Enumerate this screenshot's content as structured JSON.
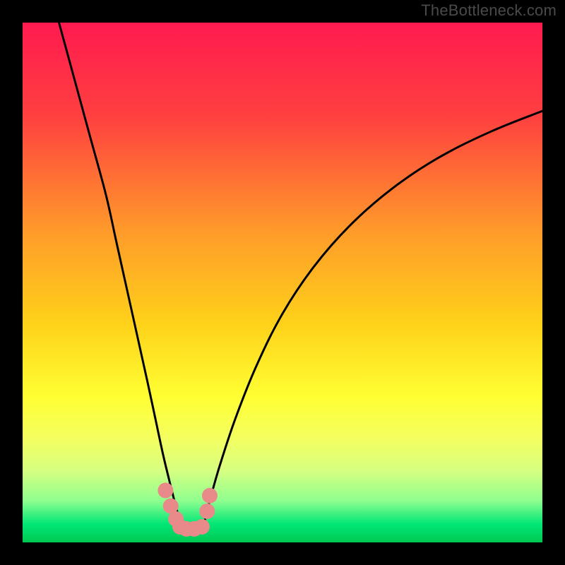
{
  "watermark": "TheBottleneck.com",
  "chart_data": {
    "type": "line",
    "title": "",
    "xlabel": "",
    "ylabel": "",
    "xlim": [
      0,
      100
    ],
    "ylim": [
      0,
      100
    ],
    "grid": false,
    "legend": false,
    "background_gradient_stops": [
      {
        "offset": 0.0,
        "color": "#ff1a4f"
      },
      {
        "offset": 0.18,
        "color": "#ff4040"
      },
      {
        "offset": 0.4,
        "color": "#ff9a2a"
      },
      {
        "offset": 0.58,
        "color": "#ffd21a"
      },
      {
        "offset": 0.72,
        "color": "#ffff33"
      },
      {
        "offset": 0.8,
        "color": "#f4ff60"
      },
      {
        "offset": 0.86,
        "color": "#d8ff80"
      },
      {
        "offset": 0.92,
        "color": "#8fff8f"
      },
      {
        "offset": 0.965,
        "color": "#00e676"
      },
      {
        "offset": 1.0,
        "color": "#00c853"
      }
    ],
    "series": [
      {
        "name": "left-branch",
        "x": [
          7,
          10,
          13,
          16,
          18,
          20,
          22,
          24,
          25.5,
          27,
          28.2,
          29.2,
          30.0,
          30.6
        ],
        "y": [
          100,
          89,
          78,
          67,
          58,
          49,
          40,
          31,
          24,
          17,
          12,
          8,
          5,
          3
        ]
      },
      {
        "name": "right-branch",
        "x": [
          35,
          36,
          38,
          41,
          45,
          50,
          56,
          63,
          71,
          80,
          90,
          100
        ],
        "y": [
          4,
          8,
          15,
          24,
          34,
          44,
          53,
          61,
          68,
          74,
          79,
          83
        ]
      }
    ],
    "valley_floor_y": 3,
    "markers": {
      "name": "bottleneck-points",
      "color": "#e98a8a",
      "points": [
        {
          "x": 27.5,
          "y": 10.0
        },
        {
          "x": 28.5,
          "y": 7.0
        },
        {
          "x": 29.5,
          "y": 4.5
        },
        {
          "x": 30.3,
          "y": 3.0
        },
        {
          "x": 31.5,
          "y": 2.6
        },
        {
          "x": 33.0,
          "y": 2.6
        },
        {
          "x": 34.5,
          "y": 3.0
        },
        {
          "x": 35.5,
          "y": 6.0
        },
        {
          "x": 36.0,
          "y": 9.0
        }
      ]
    }
  }
}
